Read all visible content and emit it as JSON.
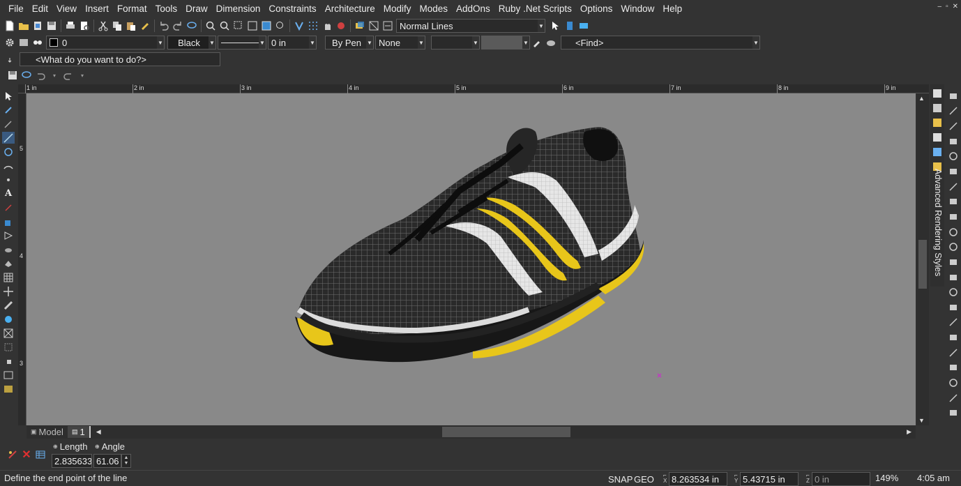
{
  "menu": [
    "File",
    "Edit",
    "View",
    "Insert",
    "Format",
    "Tools",
    "Draw",
    "Dimension",
    "Constraints",
    "Architecture",
    "Modify",
    "Modes",
    "AddOns",
    "Ruby .Net Scripts",
    "Options",
    "Window",
    "Help"
  ],
  "window_controls": [
    "–",
    "▫",
    "✕"
  ],
  "toolbar": {
    "line_style": "Normal Lines",
    "layer_value": "0",
    "color_name": "Black",
    "line_width": "0 in",
    "pen_mode": "By Pen",
    "fill_mode": "None",
    "find_placeholder": "<Find>",
    "what_do_you_want": "<What do you want to do?>"
  },
  "ruler": {
    "top_labels": [
      "1 in",
      "2 in",
      "3 in",
      "4 in",
      "5 in",
      "6 in",
      "7 in",
      "8 in",
      "9 in"
    ],
    "left_labels": [
      "5",
      "4",
      "3"
    ]
  },
  "panel": {
    "title": "Advanced Rendering Styles"
  },
  "tabs": {
    "model": "Model",
    "page": "1"
  },
  "inspector": {
    "length_label": "Length",
    "angle_label": "Angle",
    "length_value": "2.835633",
    "angle_value": "61.06"
  },
  "status": {
    "prompt": "Define the end point of the line",
    "snap": "SNAP",
    "geo": "GEO",
    "x_label": "X",
    "x_value": "8.263534 in",
    "y_label": "Y",
    "y_value": "5.43715 in",
    "z_label": "Z",
    "z_value": "0 in",
    "zoom": "149%",
    "time": "4:05 am"
  },
  "colors": {
    "viewport_bg": "#898989",
    "ui_bg": "#333333",
    "accent_yellow": "#e8c61a",
    "cursor_magenta": "#c03cc0"
  }
}
